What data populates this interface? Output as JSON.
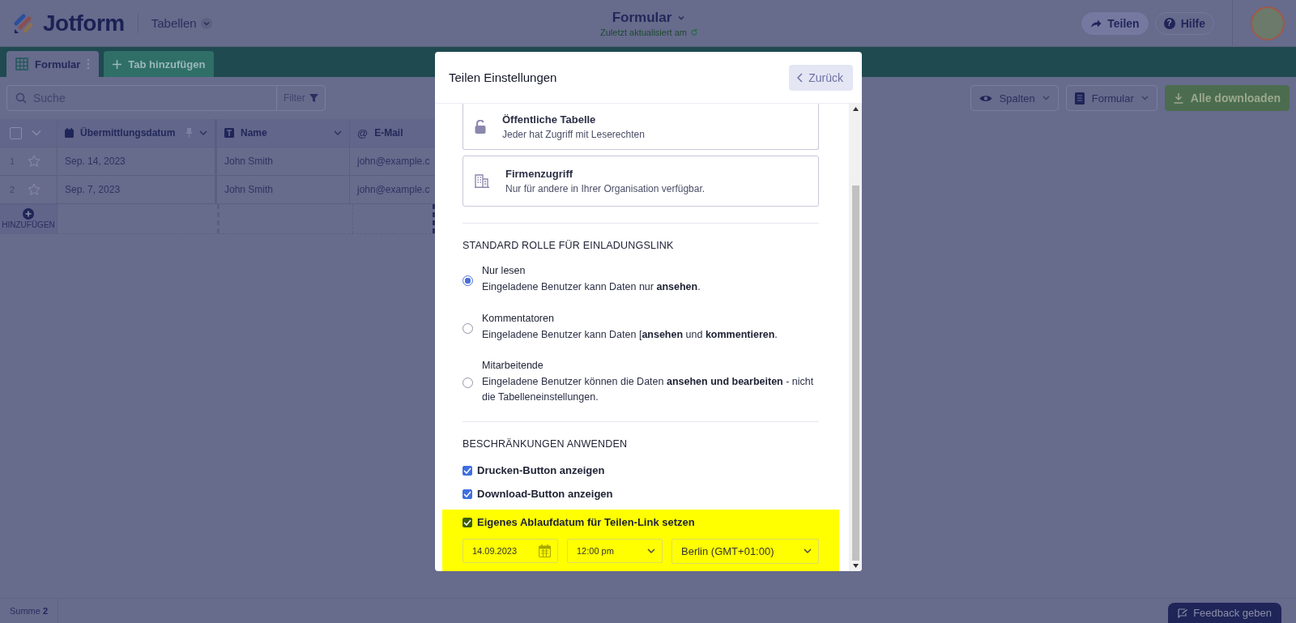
{
  "header": {
    "logo": "Jotform",
    "section_menu": "Tabellen",
    "title": "Formular",
    "subtitle": "Zuletzt aktualisiert am",
    "buttons": [
      {
        "kind": "share",
        "label": "Teilen"
      },
      {
        "kind": "help",
        "label": "Hilfe",
        "icon": "?"
      }
    ]
  },
  "tabs": [
    {
      "label": "Formular",
      "selected": true
    },
    {
      "label": "Tab hinzufügen",
      "selected": false
    }
  ],
  "toolbar": {
    "search": {
      "placeholder": "Suche"
    },
    "filter": "Filter",
    "buttons": [
      {
        "kind": "columns",
        "label": "Spalten"
      },
      {
        "kind": "form",
        "label": "Formular"
      },
      {
        "kind": "download",
        "label": "Alle downloaden"
      }
    ]
  },
  "table": {
    "select_all_checked": false,
    "columns": [
      {
        "kind": "date",
        "label": "Übermittlungsdatum"
      },
      {
        "kind": "text",
        "label": "Name"
      },
      {
        "kind": "email",
        "label": "E-Mail",
        "icon": "@"
      }
    ],
    "rows": [
      {
        "number": "1",
        "starred": false,
        "cells": [
          "Sep. 14, 2023",
          "John Smith",
          "john@example.c"
        ]
      },
      {
        "number": "2",
        "starred": false,
        "cells": [
          "Sep. 7, 2023",
          "John Smith",
          "john@example.c"
        ]
      }
    ],
    "add_label": "HINZUFÜGEN"
  },
  "status_bar": {
    "summary": "Summe **2**"
  },
  "feedback_button": "Feedback geben",
  "dialog": {
    "title": "Teilen Einstellungen",
    "back_button": "Zurück",
    "access_options": [
      {
        "kind": "public",
        "title": "Öffentliche Tabelle",
        "description": "Jeder hat Zugriff mit Leserechten"
      },
      {
        "kind": "company",
        "title": "Firmenzugriff",
        "description": "Nur für andere in Ihrer Organisation verfügbar."
      }
    ],
    "role_heading": "STANDARD ROLLE FÜR EINLADUNGSLINK",
    "roles": [
      {
        "title": "Nur lesen",
        "description": "Eingeladene Benutzer kann Daten nur **ansehen**.",
        "selected": true
      },
      {
        "title": "Kommentatoren",
        "description": "Eingeladene Benutzer kann Daten [**ansehen** und **kommentieren**.",
        "selected": false
      },
      {
        "title": "Mitarbeitende",
        "description": "Eingeladene Benutzer können die Daten **ansehen und bearbeiten** - nicht die Tabelleneinstellungen.",
        "selected": false
      }
    ],
    "restrictions_heading": "BESCHRÄNKUNGEN ANWENDEN",
    "restrictions": [
      {
        "label": "Drucken-Button anzeigen",
        "checked": true
      },
      {
        "label": "Download-Button anzeigen",
        "checked": true
      }
    ],
    "expiry": {
      "label": "Eigenes Ablaufdatum für Teilen-Link setzen",
      "checked": true,
      "highlighted": true,
      "date": "14.09.2023",
      "time": "12:00 pm",
      "timezone": "Berlin (GMT+01:00)"
    }
  }
}
